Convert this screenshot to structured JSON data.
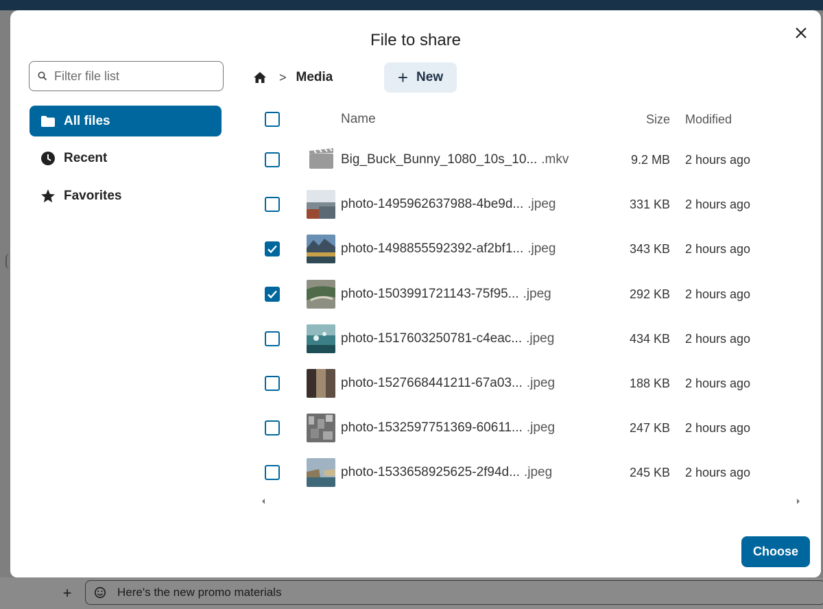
{
  "dialog": {
    "title": "File to share",
    "filter": {
      "placeholder": "Filter file list",
      "value": ""
    },
    "nav": [
      {
        "label": "All files",
        "icon": "folder-icon",
        "active": true
      },
      {
        "label": "Recent",
        "icon": "clock-icon",
        "active": false
      },
      {
        "label": "Favorites",
        "icon": "star-icon",
        "active": false
      }
    ],
    "breadcrumb": {
      "current": "Media",
      "separator": ">"
    },
    "new_label": "New",
    "columns": {
      "name": "Name",
      "size": "Size",
      "modified": "Modified"
    },
    "files": [
      {
        "name": "Big_Buck_Bunny_1080_10s_10...",
        "ext": ".mkv",
        "size": "9.2 MB",
        "modified": "2 hours ago",
        "checked": false,
        "thumb": "video-icon"
      },
      {
        "name": "photo-1495962637988-4be9d...",
        "ext": ".jpeg",
        "size": "331 KB",
        "modified": "2 hours ago",
        "checked": false,
        "thumb": "image"
      },
      {
        "name": "photo-1498855592392-af2bf1...",
        "ext": ".jpeg",
        "size": "343 KB",
        "modified": "2 hours ago",
        "checked": true,
        "thumb": "image"
      },
      {
        "name": "photo-1503991721143-75f95...",
        "ext": ".jpeg",
        "size": "292 KB",
        "modified": "2 hours ago",
        "checked": true,
        "thumb": "image"
      },
      {
        "name": "photo-1517603250781-c4eac...",
        "ext": ".jpeg",
        "size": "434 KB",
        "modified": "2 hours ago",
        "checked": false,
        "thumb": "image"
      },
      {
        "name": "photo-1527668441211-67a03...",
        "ext": ".jpeg",
        "size": "188 KB",
        "modified": "2 hours ago",
        "checked": false,
        "thumb": "image"
      },
      {
        "name": "photo-1532597751369-60611...",
        "ext": ".jpeg",
        "size": "247 KB",
        "modified": "2 hours ago",
        "checked": false,
        "thumb": "image"
      },
      {
        "name": "photo-1533658925625-2f94d...",
        "ext": ".jpeg",
        "size": "245 KB",
        "modified": "2 hours ago",
        "checked": false,
        "thumb": "image"
      }
    ],
    "choose_label": "Choose"
  },
  "background": {
    "message_input": "Here's the new promo materials",
    "add_label": "+"
  },
  "colors": {
    "primary": "#00679e",
    "new_button_bg": "#e6eef5",
    "overlay": "#7f7f7f"
  }
}
